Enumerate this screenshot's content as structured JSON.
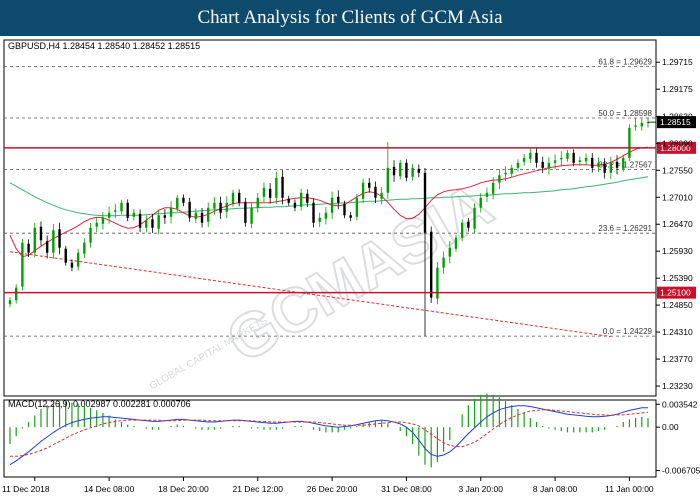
{
  "banner": {
    "title": "Chart Analysis for Clients of GCM Asia"
  },
  "watermark": {
    "main": "GCMASIA",
    "sub": "GLOBAL CAPITAL MARKETS"
  },
  "chart_data": {
    "type": "candlestick",
    "info_line": "GBPUSD,H4  1.28454 1.28540 1.28452 1.28515",
    "current_price": 1.28515,
    "colors": {
      "bull": "#00a000",
      "bear": "#000000",
      "ma_fast": "#e0233f",
      "ma_slow": "#3cb371",
      "level": "#c8102e",
      "trend": "#e03030",
      "grid": "#555555",
      "macd": "#1f3fd0",
      "signal": "#e03030",
      "hist": "#1aa01a"
    },
    "price_axis": {
      "ylim": [
        1.2303,
        1.3016
      ],
      "ticks": [
        "1.29715",
        "1.29175",
        "1.28630",
        "1.28090",
        "1.27550",
        "1.27010",
        "1.26470",
        "1.25930",
        "1.25390",
        "1.24850",
        "1.24310",
        "1.23770",
        "1.23230"
      ]
    },
    "fib_levels": [
      {
        "label": "61.8 = 1.29629",
        "value": 1.29629
      },
      {
        "label": "50.0 = 1.28598",
        "value": 1.28598
      },
      {
        "label": "38.2 = 1.27567",
        "value": 1.27567
      },
      {
        "label": "23.6 = 1.26291",
        "value": 1.26291
      },
      {
        "label": "0.0 = 1.24229",
        "value": 1.24229
      }
    ],
    "horizontal_levels": [
      {
        "label": "1.28000",
        "value": 1.28
      },
      {
        "label": "1.25100",
        "value": 1.251
      }
    ],
    "trendline": {
      "from": [
        0,
        1.2592
      ],
      "to": [
        97,
        1.2422
      ]
    },
    "x_axis": {
      "labels": [
        {
          "text": "11 Dec 2018",
          "index": 4
        },
        {
          "text": "14 Dec 08:00",
          "index": 16
        },
        {
          "text": "18 Dec 20:00",
          "index": 28
        },
        {
          "text": "21 Dec 12:00",
          "index": 40
        },
        {
          "text": "26 Dec 20:00",
          "index": 52
        },
        {
          "text": "31 Dec 08:00",
          "index": 64
        },
        {
          "text": "3 Jan 20:00",
          "index": 76
        },
        {
          "text": "8 Jan 08:00",
          "index": 88
        },
        {
          "text": "11 Jan 00:00",
          "index": 100
        }
      ]
    },
    "close": [
      1.2495,
      1.252,
      1.261,
      1.259,
      1.264,
      1.2615,
      1.259,
      1.2635,
      1.26,
      1.257,
      1.256,
      1.259,
      1.261,
      1.264,
      1.265,
      1.266,
      1.267,
      1.2675,
      1.269,
      1.266,
      1.267,
      1.264,
      1.2655,
      1.264,
      1.2665,
      1.266,
      1.268,
      1.27,
      1.269,
      1.266,
      1.267,
      1.265,
      1.268,
      1.269,
      1.267,
      1.269,
      1.271,
      1.269,
      1.265,
      1.268,
      1.27,
      1.272,
      1.27,
      1.274,
      1.27,
      1.269,
      1.268,
      1.271,
      1.269,
      1.265,
      1.266,
      1.267,
      1.27,
      1.269,
      1.2665,
      1.266,
      1.27,
      1.273,
      1.272,
      1.27,
      1.271,
      1.276,
      1.2745,
      1.277,
      1.274,
      1.276,
      1.275,
      1.263,
      1.25,
      1.256,
      1.258,
      1.26,
      1.262,
      1.265,
      1.264,
      1.268,
      1.27,
      1.271,
      1.273,
      1.2745,
      1.275,
      1.276,
      1.277,
      1.278,
      1.279,
      1.277,
      1.276,
      1.277,
      1.2775,
      1.278,
      1.279,
      1.277,
      1.2775,
      1.278,
      1.276,
      1.277,
      1.275,
      1.277,
      1.276,
      1.278,
      1.284,
      1.2845,
      1.285,
      1.28515
    ],
    "ma_fast": [
      1.2625,
      1.2598,
      1.2582,
      1.2585,
      1.2594,
      1.2603,
      1.2611,
      1.2618,
      1.2625,
      1.2631,
      1.2637,
      1.2644,
      1.2652,
      1.2658,
      1.2661,
      1.266,
      1.2655,
      1.2649,
      1.2643,
      1.2639,
      1.264,
      1.2646,
      1.2655,
      1.2665,
      1.2675,
      1.268,
      1.268,
      1.2677,
      1.267,
      1.2664,
      1.2661,
      1.2663,
      1.2667,
      1.2673,
      1.2679,
      1.2684,
      1.2688,
      1.269,
      1.269,
      1.269,
      1.269,
      1.269,
      1.269,
      1.2692,
      1.2694,
      1.2697,
      1.2699,
      1.27,
      1.27,
      1.2698,
      1.2695,
      1.269,
      1.2685,
      1.2684,
      1.2686,
      1.2694,
      1.2702,
      1.2709,
      1.2712,
      1.271,
      1.2703,
      1.2691,
      1.2677,
      1.2665,
      1.2658,
      1.2659,
      1.2667,
      1.268,
      1.2695,
      1.2706,
      1.2712,
      1.2715,
      1.2716,
      1.2718,
      1.2721,
      1.2725,
      1.273,
      1.2733,
      1.2735,
      1.2736,
      1.2738,
      1.2741,
      1.2745,
      1.2748,
      1.2751,
      1.2754,
      1.2757,
      1.276,
      1.2762,
      1.2764,
      1.2765,
      1.2766,
      1.2766,
      1.2766,
      1.2765,
      1.2765,
      1.2767,
      1.2771,
      1.2777,
      1.2784,
      1.2791,
      1.2797,
      1.28,
      1.2801
    ],
    "ma_slow": [
      1.273,
      1.2723,
      1.2716,
      1.2709,
      1.2702,
      1.2696,
      1.269,
      1.2685,
      1.268,
      1.2676,
      1.2673,
      1.267,
      1.2668,
      1.2666,
      1.2665,
      1.2664,
      1.2664,
      1.2664,
      1.2665,
      1.2665,
      1.2665,
      1.2665,
      1.2666,
      1.2667,
      1.2668,
      1.2669,
      1.267,
      1.267,
      1.2671,
      1.2672,
      1.2673,
      1.2674,
      1.2675,
      1.2676,
      1.2676,
      1.2677,
      1.2678,
      1.2679,
      1.2679,
      1.268,
      1.268,
      1.2681,
      1.2681,
      1.2682,
      1.2682,
      1.2683,
      1.2684,
      1.2685,
      1.2686,
      1.2686,
      1.2687,
      1.2688,
      1.2688,
      1.2689,
      1.269,
      1.269,
      1.2691,
      1.2692,
      1.2693,
      1.2693,
      1.2694,
      1.2695,
      1.2696,
      1.2697,
      1.2697,
      1.2698,
      1.2698,
      1.2699,
      1.27,
      1.27,
      1.2701,
      1.2701,
      1.2702,
      1.2703,
      1.2703,
      1.2704,
      1.2705,
      1.2705,
      1.2706,
      1.2707,
      1.2708,
      1.2708,
      1.2709,
      1.271,
      1.271,
      1.2711,
      1.2712,
      1.2713,
      1.2714,
      1.2716,
      1.2717,
      1.2718,
      1.272,
      1.2722,
      1.2723,
      1.2725,
      1.2727,
      1.2729,
      1.2731,
      1.2734,
      1.2736,
      1.2738,
      1.274,
      1.2742
    ],
    "macd": {
      "label": "MACD(12,26,9) 0.002987 0.002281 0.000706",
      "ylim": [
        -0.0077,
        0.0042
      ],
      "ticks": [
        "0.003542",
        "0.00",
        "-0.006705"
      ],
      "macd": [
        -0.0058,
        -0.0052,
        -0.0045,
        -0.0038,
        -0.003,
        -0.0022,
        -0.0015,
        -0.0008,
        -0.0002,
        0.0003,
        0.0007,
        0.001,
        0.0012,
        0.0014,
        0.0015,
        0.0016,
        0.0016,
        0.0015,
        0.0014,
        0.0013,
        0.0012,
        0.0011,
        0.001,
        0.0009,
        0.0009,
        0.001,
        0.0011,
        0.0012,
        0.0012,
        0.0011,
        0.001,
        0.0009,
        0.0008,
        0.0008,
        0.0009,
        0.001,
        0.0011,
        0.0011,
        0.001,
        0.0009,
        0.0008,
        0.0007,
        0.0006,
        0.0006,
        0.0007,
        0.0008,
        0.0009,
        0.0009,
        0.0008,
        0.0006,
        0.0004,
        0.0002,
        0.0001,
        0.0,
        0.0001,
        0.0002,
        0.0004,
        0.0006,
        0.0008,
        0.001,
        0.0011,
        0.001,
        0.0008,
        0.0005,
        0.0,
        -0.0008,
        -0.002,
        -0.0033,
        -0.0042,
        -0.0045,
        -0.0043,
        -0.0038,
        -0.003,
        -0.002,
        -0.001,
        -0.0001,
        0.0008,
        0.0016,
        0.0022,
        0.0027,
        0.003,
        0.0032,
        0.0033,
        0.0033,
        0.0032,
        0.003,
        0.0028,
        0.0026,
        0.0024,
        0.0022,
        0.002,
        0.0019,
        0.0018,
        0.0017,
        0.0016,
        0.0016,
        0.0017,
        0.0018,
        0.002,
        0.0023,
        0.0026,
        0.0028,
        0.003,
        0.003
      ],
      "signal": [
        -0.0045,
        -0.0045,
        -0.0044,
        -0.0042,
        -0.0039,
        -0.0036,
        -0.0032,
        -0.0027,
        -0.0022,
        -0.0017,
        -0.0012,
        -0.0008,
        -0.0004,
        -0.0001,
        0.0002,
        0.0005,
        0.0007,
        0.0009,
        0.001,
        0.0011,
        0.0011,
        0.0011,
        0.0011,
        0.0011,
        0.0011,
        0.001,
        0.001,
        0.001,
        0.0011,
        0.0011,
        0.0011,
        0.0011,
        0.001,
        0.001,
        0.001,
        0.001,
        0.001,
        0.001,
        0.001,
        0.001,
        0.0009,
        0.0009,
        0.0008,
        0.0008,
        0.0008,
        0.0008,
        0.0008,
        0.0008,
        0.0008,
        0.0008,
        0.0007,
        0.0006,
        0.0005,
        0.0004,
        0.0003,
        0.0003,
        0.0003,
        0.0003,
        0.0004,
        0.0005,
        0.0006,
        0.0007,
        0.0008,
        0.0008,
        0.0007,
        0.0005,
        0.0002,
        -0.0004,
        -0.0011,
        -0.0018,
        -0.0024,
        -0.0028,
        -0.003,
        -0.003,
        -0.0027,
        -0.0023,
        -0.0017,
        -0.001,
        -0.0003,
        0.0004,
        0.001,
        0.0015,
        0.0019,
        0.0022,
        0.0025,
        0.0026,
        0.0027,
        0.0027,
        0.0026,
        0.0025,
        0.0024,
        0.0023,
        0.0022,
        0.0021,
        0.002,
        0.0019,
        0.0019,
        0.0018,
        0.0019,
        0.0019,
        0.002,
        0.0021,
        0.0022,
        0.0023
      ]
    }
  }
}
